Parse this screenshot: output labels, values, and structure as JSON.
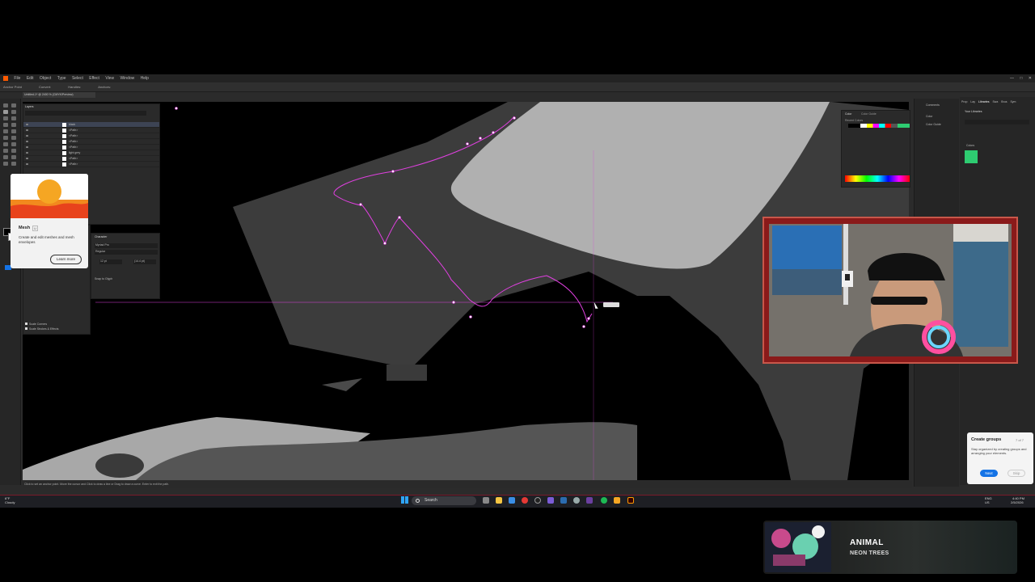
{
  "app": {
    "menu_items": [
      "File",
      "Edit",
      "Object",
      "Type",
      "Select",
      "Effect",
      "View",
      "Window",
      "Help"
    ],
    "control_bar_label": "Anchor Point",
    "control_bar_items": [
      "Convert:",
      "Handles:",
      "Anchors:"
    ],
    "doc_tab": "Untitled-1* @ 2400 % (CMYK/Preview)",
    "status_text": "Click to set an anchor point. Move the cursor and Click to draw a line or Drag to draw a curve. Enter to exit the path."
  },
  "layers_panel": {
    "tab": "Layers",
    "rows": [
      {
        "name": "black",
        "selected": true
      },
      {
        "name": "<Path>",
        "selected": false
      },
      {
        "name": "<Path>",
        "selected": false
      },
      {
        "name": "<Path>",
        "selected": false
      },
      {
        "name": "<Path>",
        "selected": false
      },
      {
        "name": "light grey",
        "selected": false
      },
      {
        "name": "<Path>",
        "selected": false
      },
      {
        "name": "<Path>",
        "selected": false
      }
    ]
  },
  "character_panel": {
    "title": "Character",
    "font": "Myriad Pro",
    "style": "Regular",
    "size": "12 pt",
    "leading": "(14.4 pt)",
    "snap": "Snap to Glyph"
  },
  "left_sub_panel": {
    "options": [
      "Scale Corners",
      "Scale Strokes & Effects"
    ]
  },
  "mesh_tooltip": {
    "title": "Mesh",
    "shortcut": "U",
    "description": "Create and edit meshes and mesh envelopes",
    "learn_more": "Learn more"
  },
  "color_panel": {
    "tabs": [
      "Color",
      "Color Guide"
    ],
    "recent_label": "Recent Colors"
  },
  "props_strip": {
    "items": [
      "Comments",
      "Color",
      "Color Guide"
    ]
  },
  "libraries_panel": {
    "tabs": [
      "Prop",
      "Lay",
      "Libraries",
      "Swa",
      "Brus",
      "Sym"
    ],
    "title": "Your Libraries",
    "section": "Colors",
    "swatch_color": "#2ecc71"
  },
  "groups_tip": {
    "title": "Create groups",
    "step": "7 of 7",
    "description": "Stay organized by creating groups and arranging your elements.",
    "next": "Next",
    "skip": "Skip"
  },
  "taskbar": {
    "weather_temp": "6°F",
    "weather_desc": "Cloudy",
    "search_placeholder": "Search",
    "lang": "ENG",
    "region": "US",
    "time": "4:40 PM",
    "date": "2/5/2026"
  },
  "music": {
    "title": "ANIMAL",
    "artist": "NEON TREES"
  },
  "colors": {
    "path_highlight": "#e040e0",
    "canvas_grey": "#8a8a8a",
    "canvas_light": "#b0b0b0",
    "canvas_dark": "#3c3c3c"
  }
}
